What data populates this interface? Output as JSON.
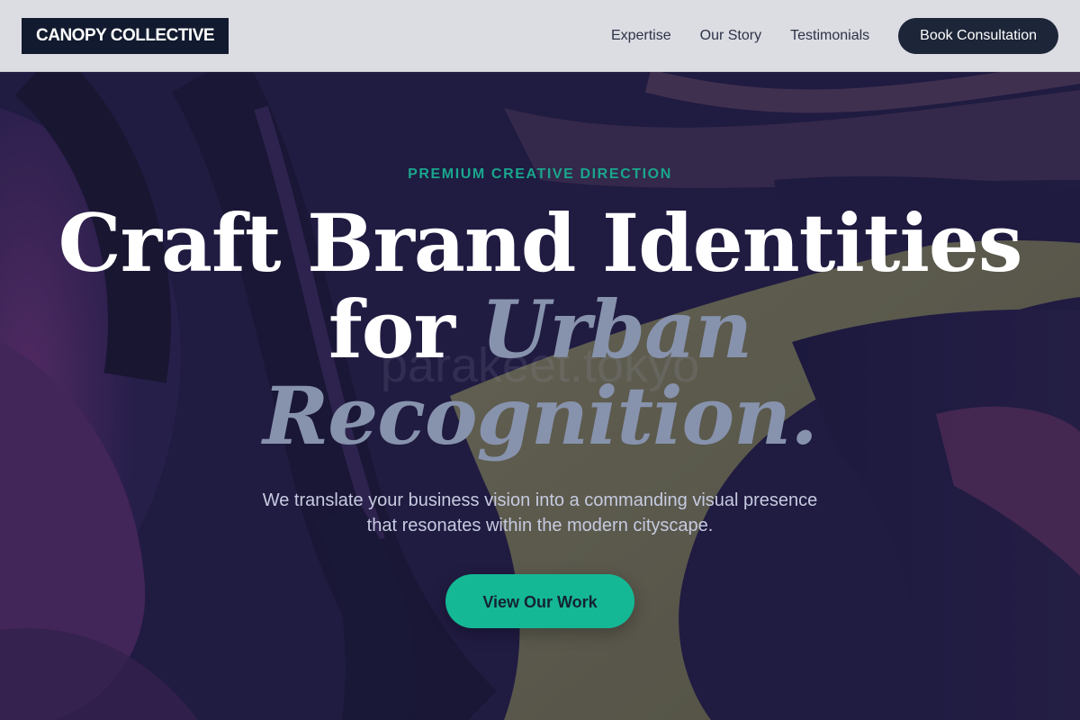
{
  "header": {
    "logo": "CANOPY COLLECTIVE",
    "nav": [
      "Expertise",
      "Our Story",
      "Testimonials"
    ],
    "cta_label": "Book Consultation"
  },
  "hero": {
    "eyebrow": "PREMIUM CREATIVE DIRECTION",
    "headline": {
      "line1": "Craft Brand Identities",
      "line2_plain": "for ",
      "line2_accent": "Urban",
      "line3_accent": "Recognition."
    },
    "watermark": "parakeet.tokyo",
    "subtitle_line1": "We translate your business vision into a commanding visual presence",
    "subtitle_line2": "that resonates within the modern cityscape.",
    "button_label": "View Our Work"
  },
  "colors": {
    "header_bg": "#dcdce3",
    "logo_bg": "#111a2e",
    "cta_bg": "#1d2538",
    "accent_teal": "#15b895",
    "eyebrow_teal": "#1aa68d",
    "headline_accent": "#8793ad",
    "hero_bg": "#221d3f"
  }
}
